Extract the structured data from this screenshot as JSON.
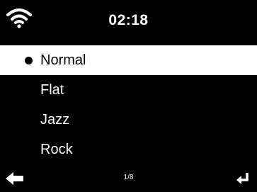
{
  "header": {
    "time": "02:18",
    "wifi_icon": "wifi-icon"
  },
  "menu": {
    "items": [
      {
        "label": "Normal",
        "selected": true
      },
      {
        "label": "Flat",
        "selected": false
      },
      {
        "label": "Jazz",
        "selected": false
      },
      {
        "label": "Rock",
        "selected": false
      }
    ]
  },
  "footer": {
    "page_indicator": "1/8",
    "back_icon": "back-arrow-icon",
    "enter_icon": "enter-icon"
  },
  "colors": {
    "background": "#000000",
    "text": "#ffffff",
    "highlight": "#ffffff",
    "highlight_text": "#000000"
  }
}
